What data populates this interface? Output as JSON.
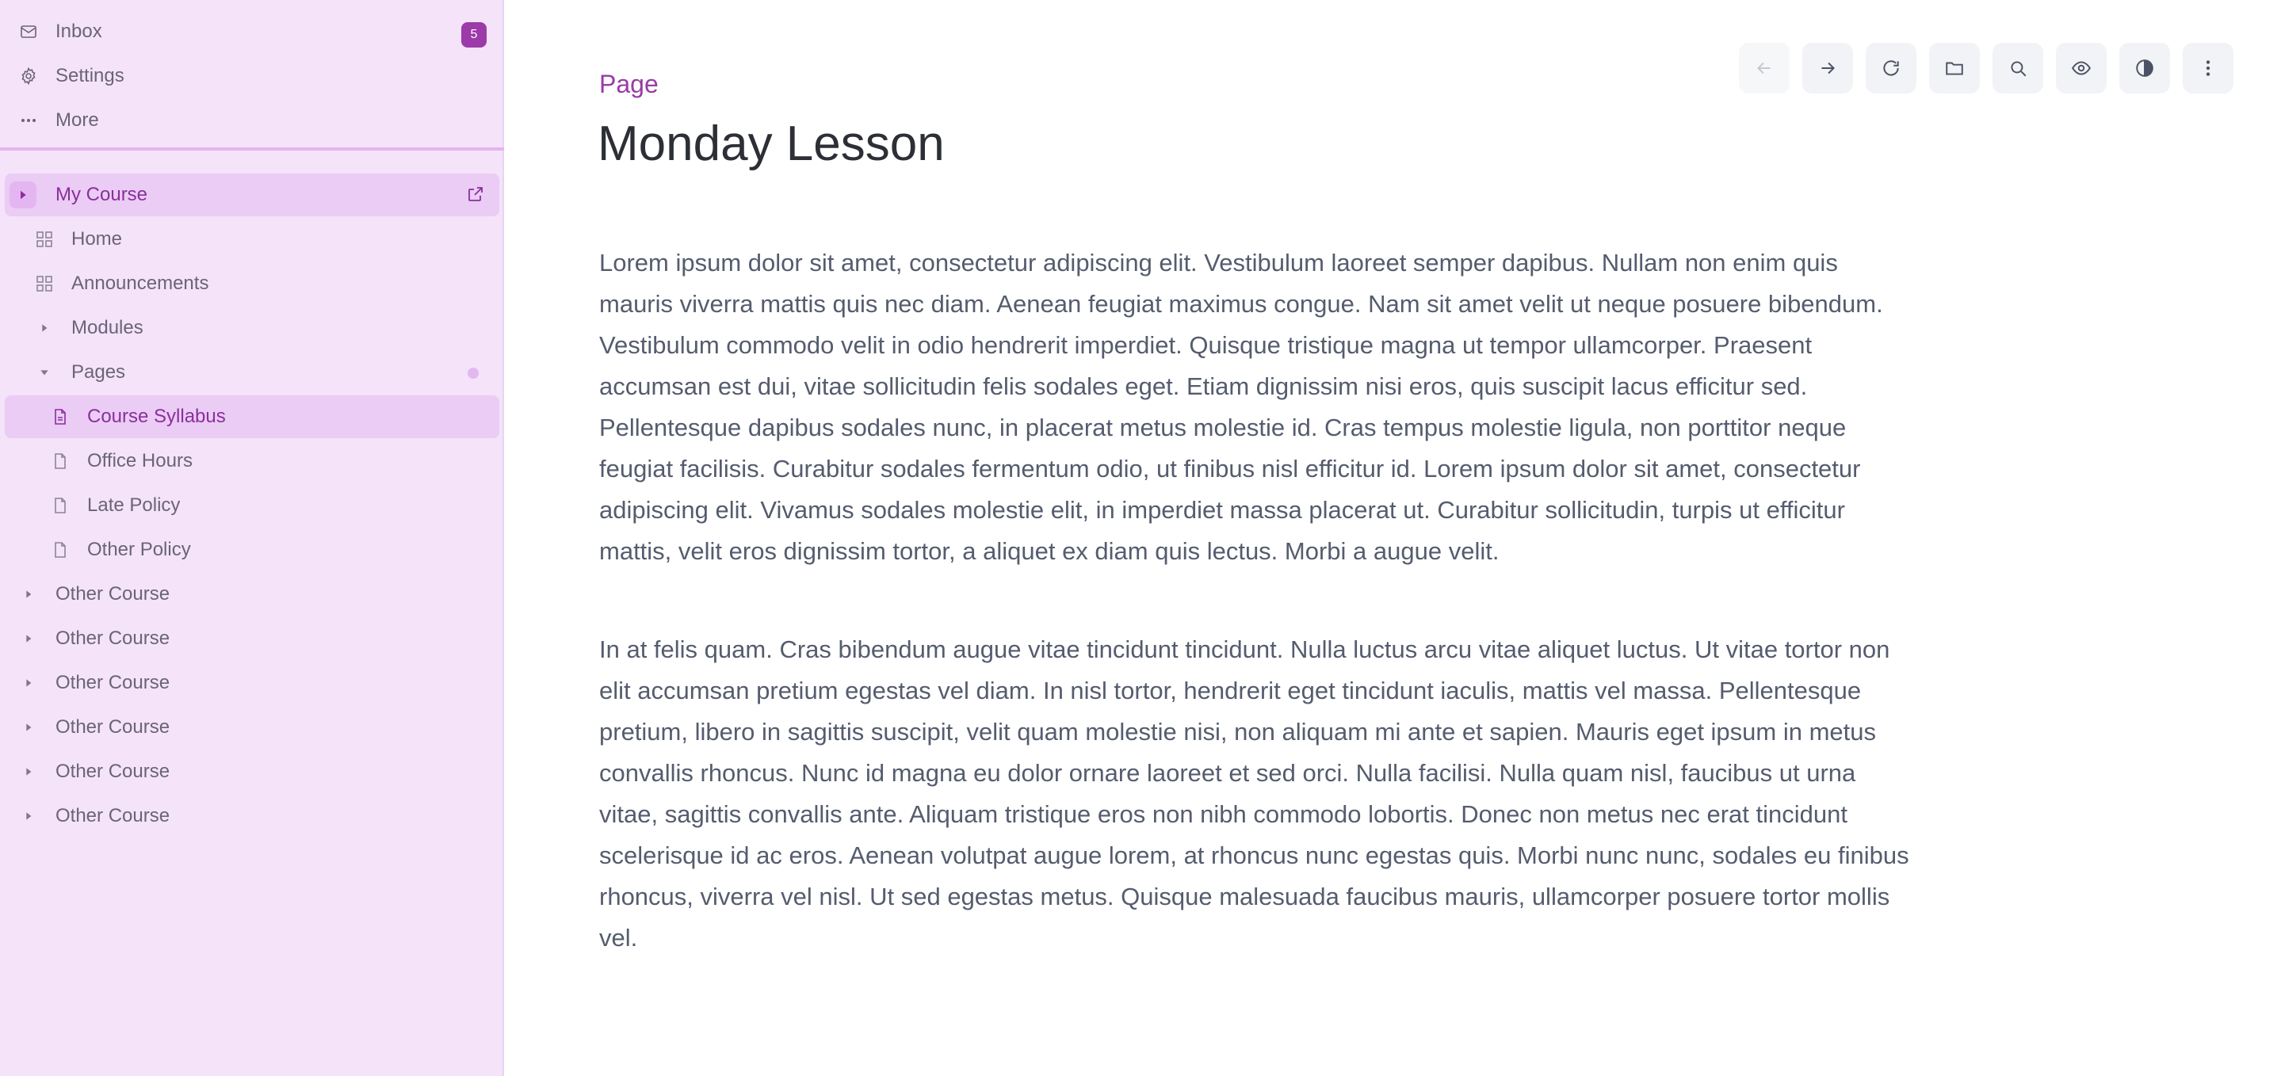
{
  "sidebar": {
    "top_items": [
      {
        "label": "Inbox",
        "icon": "mail-icon",
        "badge": "5"
      },
      {
        "label": "Settings",
        "icon": "gear-icon"
      },
      {
        "label": "More",
        "icon": "ellipsis-icon"
      }
    ],
    "course": {
      "label": "My Course"
    },
    "course_items": [
      {
        "label": "Home",
        "icon": "grid-icon"
      },
      {
        "label": "Announcements",
        "icon": "grid-icon"
      },
      {
        "label": "Modules",
        "icon": "chevron-right-icon"
      },
      {
        "label": "Pages",
        "icon": "chevron-down-icon"
      }
    ],
    "pages": [
      {
        "label": "Course Syllabus",
        "active": true
      },
      {
        "label": "Office Hours"
      },
      {
        "label": "Late Policy"
      },
      {
        "label": "Other Policy"
      }
    ],
    "other_courses": [
      {
        "label": "Other Course"
      },
      {
        "label": "Other Course"
      },
      {
        "label": "Other Course"
      },
      {
        "label": "Other Course"
      },
      {
        "label": "Other Course"
      },
      {
        "label": "Other Course"
      }
    ]
  },
  "toolbar": {
    "buttons": [
      "arrow-left-icon",
      "arrow-right-icon",
      "refresh-icon",
      "folder-icon",
      "search-icon",
      "eye-icon",
      "contrast-icon",
      "kebab-icon"
    ]
  },
  "main": {
    "breadcrumb": "Page",
    "title": "Monday Lesson",
    "paragraphs": [
      "Lorem ipsum dolor sit amet, consectetur adipiscing elit. Vestibulum laoreet semper dapibus. Nullam non enim quis mauris viverra mattis quis nec diam. Aenean feugiat maximus congue. Nam sit amet velit ut neque posuere bibendum. Vestibulum commodo velit in odio hendrerit imperdiet. Quisque tristique magna ut tempor ullamcorper. Praesent accumsan est dui, vitae sollicitudin felis sodales eget. Etiam dignissim nisi eros, quis suscipit lacus efficitur sed. Pellentesque dapibus sodales nunc, in placerat metus molestie id. Cras tempus molestie ligula, non porttitor neque feugiat facilisis. Curabitur sodales fermentum odio, ut finibus nisl efficitur id. Lorem ipsum dolor sit amet, consectetur adipiscing elit. Vivamus sodales molestie elit, in imperdiet massa placerat ut. Curabitur sollicitudin, turpis ut efficitur mattis, velit eros dignissim tortor, a aliquet ex diam quis lectus. Morbi a augue velit.",
      "In at felis quam. Cras bibendum augue vitae tincidunt tincidunt. Nulla luctus arcu vitae aliquet luctus. Ut vitae tortor non elit accumsan pretium egestas vel diam. In nisl tortor, hendrerit eget tincidunt iaculis, mattis vel massa. Pellentesque pretium, libero in sagittis suscipit, velit quam molestie nisi, non aliquam mi ante et sapien. Mauris eget ipsum in metus convallis rhoncus. Nunc id magna eu dolor ornare laoreet et sed orci. Nulla facilisi. Nulla quam nisl, faucibus ut urna vitae, sagittis convallis ante. Aliquam tristique eros non nibh commodo lobortis. Donec non metus nec erat tincidunt scelerisque id ac eros. Aenean volutpat augue lorem, at rhoncus nunc egestas quis. Morbi nunc nunc, sodales eu finibus rhoncus, viverra vel nisl. Ut sed egestas metus. Quisque malesuada faucibus mauris, ullamcorper posuere tortor mollis vel."
    ]
  },
  "colors": {
    "accent": "#9b3aa8",
    "sidebar_bg": "#f4e3f9",
    "active_bg": "#eaccf4"
  }
}
